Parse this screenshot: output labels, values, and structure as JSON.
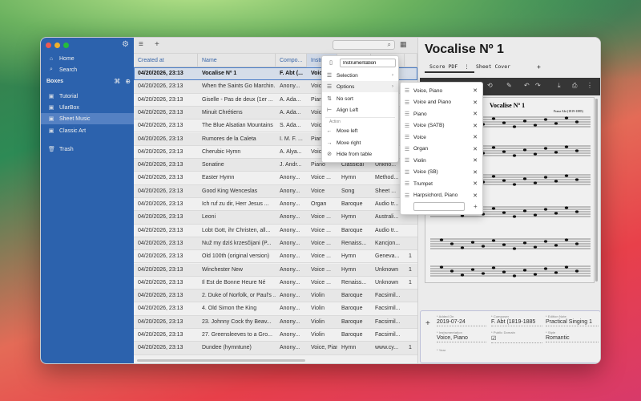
{
  "sidebar": {
    "nav": [
      {
        "label": "Home",
        "icon": "home-icon",
        "glyph": "⌂"
      },
      {
        "label": "Search",
        "icon": "search-icon",
        "glyph": "⌕"
      }
    ],
    "boxes_header": "Boxes",
    "boxes": [
      {
        "label": "Tutorial",
        "glyph": "▣"
      },
      {
        "label": "UlarBox",
        "glyph": "▣"
      },
      {
        "label": "Sheet Music",
        "glyph": "▣",
        "selected": true
      },
      {
        "label": "Classic Art",
        "glyph": "▣"
      }
    ],
    "trash": "Trash"
  },
  "table": {
    "columns": [
      "Created at",
      "Name",
      "Compo...",
      "Instr...",
      "",
      "",
      ""
    ],
    "rows": [
      [
        "04/20/2026, 23:13",
        "Vocalise Nº 1",
        "F. Abt (...",
        "Voice ...",
        "",
        "",
        ""
      ],
      [
        "04/20/2026, 23:13",
        "When the Saints Go Marchin...",
        "Anony...",
        "Voice ...",
        "",
        "",
        ""
      ],
      [
        "04/20/2026, 23:13",
        "Giselle - Pas de deux (1er ...",
        "A. Ada...",
        "Piano",
        "",
        "",
        ""
      ],
      [
        "04/20/2026, 23:13",
        "Minuit Chrétiens",
        "A. Ada...",
        "Voice ...",
        "",
        "",
        ""
      ],
      [
        "04/20/2026, 23:13",
        "The Blue Alsatian Mountains",
        "S. Ada...",
        "Voice ...",
        "",
        "",
        ""
      ],
      [
        "04/20/2026, 23:13",
        "Rumores de la Caleta",
        "I. M. F. ...",
        "Piano",
        "",
        "",
        ""
      ],
      [
        "04/20/2026, 23:13",
        "Cherubic Hymn",
        "A. Alya...",
        "Voice ...",
        "",
        "",
        ""
      ],
      [
        "04/20/2026, 23:13",
        "Sonatine",
        "J. Andr...",
        "Piano",
        "Classical",
        "Unkno...",
        ""
      ],
      [
        "04/20/2026, 23:13",
        "Easter Hymn",
        "Anony...",
        "Voice ...",
        "Hymn",
        "Method...",
        ""
      ],
      [
        "04/20/2026, 23:13",
        "Good King Wenceslas",
        "Anony...",
        "Voice",
        "Song",
        "Sheet ...",
        ""
      ],
      [
        "04/20/2026, 23:13",
        "Ich ruf zu dir, Herr Jesus ...",
        "Anony...",
        "Organ",
        "Baroque",
        "Audio tr...",
        ""
      ],
      [
        "04/20/2026, 23:13",
        "Leoni",
        "Anony...",
        "Voice ...",
        "Hymn",
        "Australi...",
        ""
      ],
      [
        "04/20/2026, 23:13",
        "Lobt Gott, ihr Christen, all...",
        "Anony...",
        "Voice ...",
        "Baroque",
        "Audio tr...",
        ""
      ],
      [
        "04/20/2026, 23:13",
        "Nuž my dziś krzesčijani (P...",
        "Anony...",
        "Voice ...",
        "Renaiss...",
        "Kancjon...",
        ""
      ],
      [
        "04/20/2026, 23:13",
        "Old 100th (original version)",
        "Anony...",
        "Voice ...",
        "Hymn",
        "Geneva...",
        "1"
      ],
      [
        "04/20/2026, 23:13",
        "Winchester New",
        "Anony...",
        "Voice ...",
        "Hymn",
        "Unknown",
        "1"
      ],
      [
        "04/20/2026, 23:13",
        "Il Est de Bonne Heure Né",
        "Anony...",
        "Voice ...",
        "Renaiss...",
        "Unknown",
        "1"
      ],
      [
        "04/20/2026, 23:13",
        "2. Duke of Norfolk, or Paul's ...",
        "Anony...",
        "Violin",
        "Baroque",
        "Facsimil...",
        ""
      ],
      [
        "04/20/2026, 23:13",
        "4. Old Simon the King",
        "Anony...",
        "Violin",
        "Baroque",
        "Facsimil...",
        ""
      ],
      [
        "04/20/2026, 23:13",
        "23. Johnny Cock thy Beav...",
        "Anony...",
        "Violin",
        "Baroque",
        "Facsimil...",
        ""
      ],
      [
        "04/20/2026, 23:13",
        "27. Greensleeves to a Gro...",
        "Anony...",
        "Violin",
        "Baroque",
        "Facsimil...",
        ""
      ],
      [
        "04/20/2026, 23:13",
        "Dundee (hymntune)",
        "Anony...",
        "Voice, Piano",
        "Hymn",
        "www.cy...",
        "1"
      ]
    ]
  },
  "detail": {
    "title": "Vocalise Nº 1",
    "tabs": [
      "Score PDF",
      "Sheet Cover"
    ],
    "tab_menu": "⋮",
    "add_tab": "+",
    "sheet_title": "Vocalise Nº 1",
    "sheet_composer": "Franz Abt (1819-1885)",
    "fields": [
      {
        "label": "* Added On",
        "value": "2019-07-24"
      },
      {
        "label": "* Composer",
        "value": "F. Abt (1819-1885"
      },
      {
        "label": "* Edition Note",
        "value": "Practical Singing 1"
      },
      {
        "label": "* Instrumentation",
        "value": "Voice, Piano"
      },
      {
        "label": "* Public Domain",
        "value": "☑"
      },
      {
        "label": "* Style",
        "value": "Romantic"
      },
      {
        "label": "* Year",
        "value": ""
      }
    ]
  },
  "context_menu": {
    "input_value": "Instrumentation",
    "items": [
      {
        "label": "Selection",
        "glyph": "☰",
        "submenu": true
      },
      {
        "label": "Options",
        "glyph": "☰",
        "submenu": true
      },
      {
        "label": "No sort",
        "glyph": "⇅"
      },
      {
        "label": "Align Left",
        "glyph": "⊢"
      }
    ],
    "section": "Action",
    "actions": [
      {
        "label": "Move left",
        "glyph": "←"
      },
      {
        "label": "Move right",
        "glyph": "→"
      },
      {
        "label": "Hide from table",
        "glyph": "⊘"
      }
    ]
  },
  "options_menu": {
    "items": [
      "Voice, Piano",
      "Voice and Piano",
      "Piano",
      "Voice (SATB)",
      "Voice",
      "Organ",
      "Violin",
      "Voice (SB)",
      "Trumpet",
      "Harpsichord, Piano"
    ],
    "add": "+"
  }
}
